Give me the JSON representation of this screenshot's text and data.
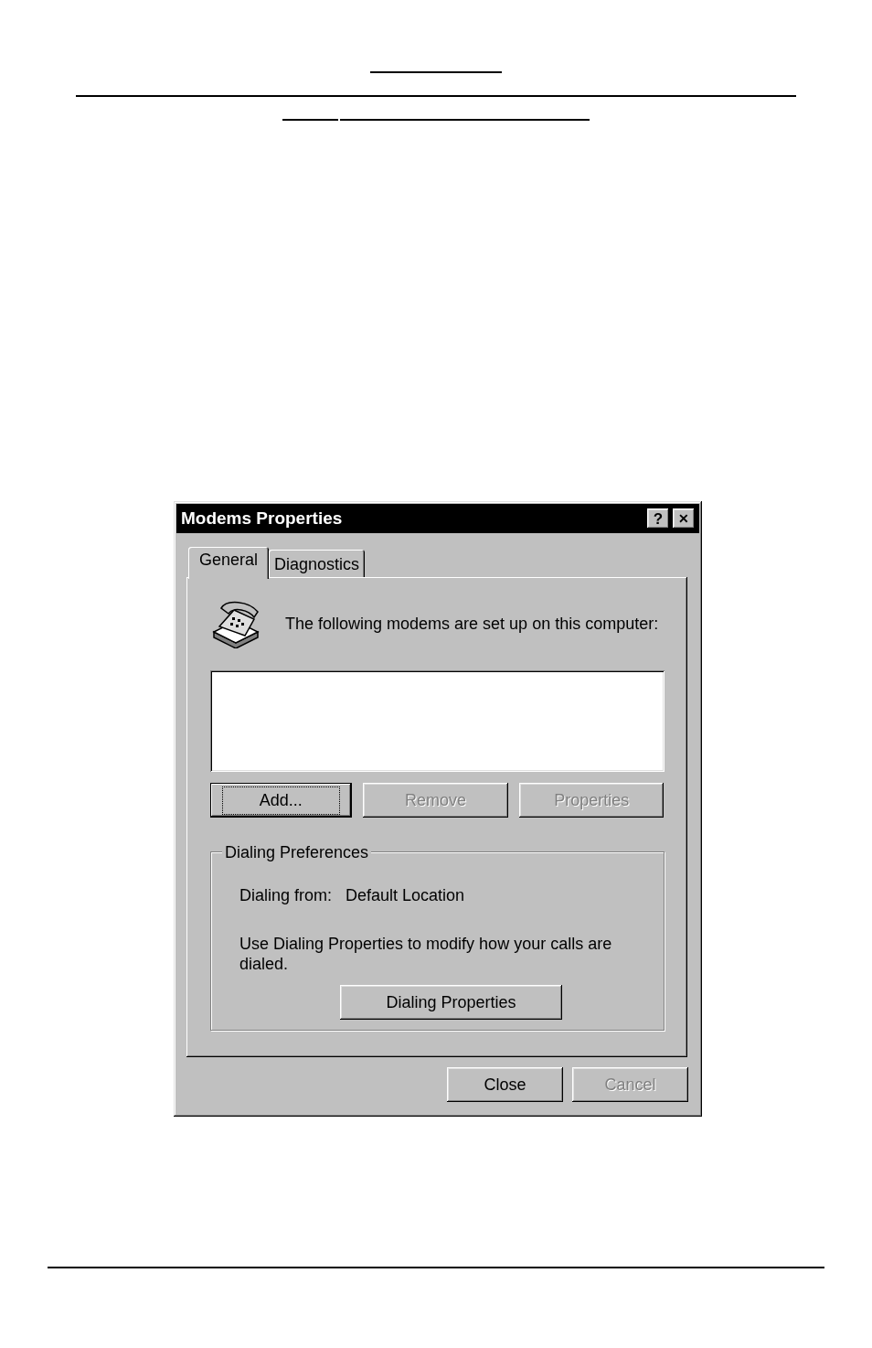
{
  "window": {
    "title": "Modems Properties",
    "title_buttons": [
      {
        "kind": "help",
        "label": "?"
      },
      {
        "kind": "close",
        "label": "✕"
      }
    ]
  },
  "tabs": [
    {
      "label": "General",
      "selected": true
    },
    {
      "label": "Diagnostics",
      "selected": false
    }
  ],
  "intro": "The following modems are set up on this computer:",
  "modem_buttons": [
    {
      "label": "Add...",
      "disabled": false,
      "default": true
    },
    {
      "label": "Remove",
      "disabled": true,
      "default": false
    },
    {
      "label": "Properties",
      "disabled": true,
      "default": false
    }
  ],
  "dialing_preferences": {
    "legend": "Dialing Preferences",
    "from_label": "Dialing from:",
    "from_value": "Default Location",
    "note": "Use Dialing Properties to modify how your calls are dialed.",
    "button": {
      "label": "Dialing Properties",
      "disabled": false
    }
  },
  "footer_buttons": [
    {
      "label": "Close",
      "disabled": false
    },
    {
      "label": "Cancel",
      "disabled": true
    }
  ]
}
